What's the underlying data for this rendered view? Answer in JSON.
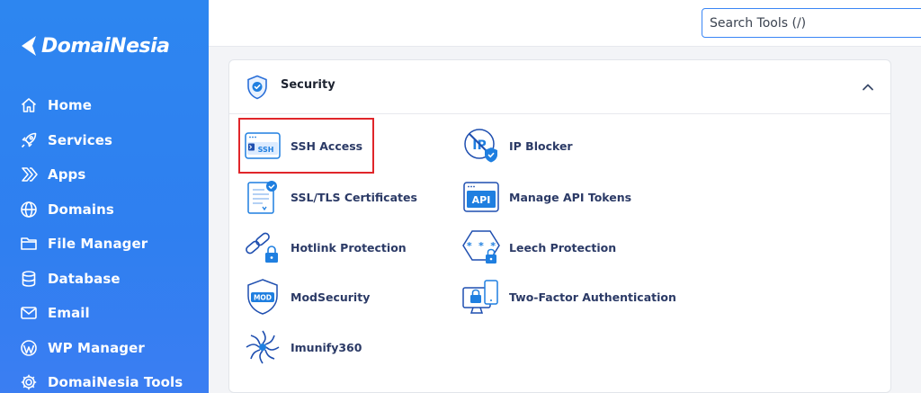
{
  "brand": {
    "name": "DomaiNesia"
  },
  "sidebar": {
    "items": [
      {
        "label": "Home",
        "icon": "home-icon"
      },
      {
        "label": "Services",
        "icon": "rocket-icon"
      },
      {
        "label": "Apps",
        "icon": "apps-chevron-icon"
      },
      {
        "label": "Domains",
        "icon": "globe-icon"
      },
      {
        "label": "File Manager",
        "icon": "folder-icon"
      },
      {
        "label": "Database",
        "icon": "database-icon"
      },
      {
        "label": "Email",
        "icon": "envelope-icon"
      },
      {
        "label": "WP Manager",
        "icon": "wordpress-icon"
      },
      {
        "label": "DomaiNesia Tools",
        "icon": "gear-icon"
      }
    ]
  },
  "search": {
    "placeholder": "Search Tools (/)"
  },
  "panel": {
    "title": "Security",
    "tools": [
      {
        "label": "SSH Access",
        "icon": "ssh-terminal-icon",
        "highlighted": true
      },
      {
        "label": "IP Blocker",
        "icon": "ip-blocker-icon"
      },
      {
        "label": "SSL/TLS Certificates",
        "icon": "certificate-icon"
      },
      {
        "label": "Manage API Tokens",
        "icon": "api-icon"
      },
      {
        "label": "Hotlink Protection",
        "icon": "link-lock-icon"
      },
      {
        "label": "Leech Protection",
        "icon": "password-lock-icon"
      },
      {
        "label": "ModSecurity",
        "icon": "modsecurity-shield-icon"
      },
      {
        "label": "Two-Factor Authentication",
        "icon": "two-factor-icon"
      },
      {
        "label": "Imunify360",
        "icon": "imunify-icon"
      }
    ]
  },
  "colors": {
    "sidebar": "#2f80f0",
    "accent": "#1f7fe0",
    "highlight": "#e0262a",
    "tool_text": "#2b3a66"
  }
}
